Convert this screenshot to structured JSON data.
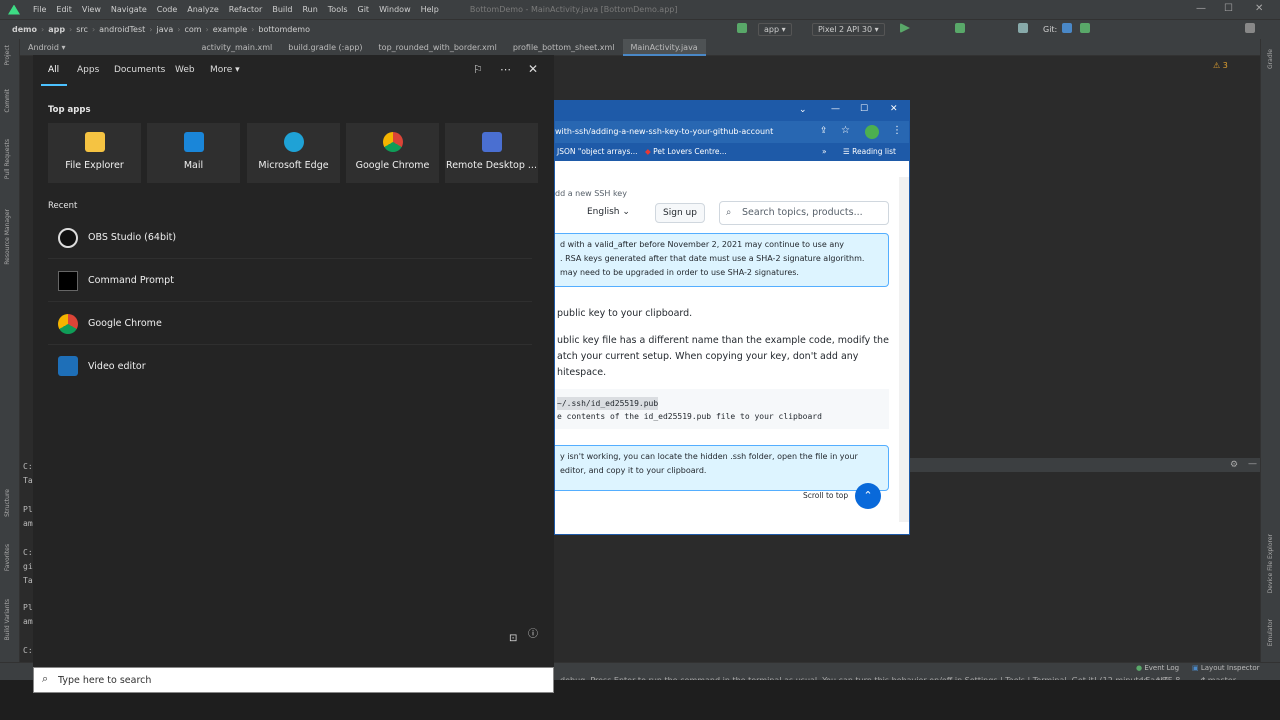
{
  "ide": {
    "menu": [
      "File",
      "Edit",
      "View",
      "Navigate",
      "Code",
      "Analyze",
      "Refactor",
      "Build",
      "Run",
      "Tools",
      "Git",
      "Window",
      "Help"
    ],
    "window_title": "BottomDemo - MainActivity.java [BottomDemo.app]",
    "breadcrumbs": [
      "demo",
      "app",
      "src",
      "androidTest",
      "java",
      "com",
      "example",
      "bottomdemo"
    ],
    "run_config": "app",
    "device": "Pixel 2 API 30",
    "git_label": "Git:",
    "project_view": "Android",
    "tabs": [
      "activity_main.xml",
      "build.gradle (:app)",
      "top_rounded_with_border.xml",
      "profile_bottom_sheet.xml",
      "MainActivity.java"
    ],
    "warning_count": "3",
    "left_panels": [
      "Project",
      "Commit",
      "Pull Requests",
      "Resource Manager",
      "Structure",
      "Favorites",
      "Build Variants"
    ],
    "right_panels": [
      "Gradle",
      "Device File Explorer",
      "Emulator"
    ],
    "terminal_fragments": [
      "C:",
      "Ta",
      "Pl",
      "am",
      "C:",
      "gi",
      "Ta",
      "Pl",
      "am",
      "C:"
    ],
    "status_message": "debug. Press Enter to run the command in the terminal as usual. You can turn this behavior on/off in Settings | Tools | Terminal. Got it! (12 minutes ago)",
    "status_lf": "LF",
    "status_encoding": "UTF-8",
    "status_branch": "master",
    "event_log": "Event Log",
    "layout_inspector": "Layout Inspector"
  },
  "browser": {
    "url": "with-ssh/adding-a-new-ssh-key-to-your-github-account",
    "bookmarks": [
      "JSON \"object arrays...",
      "Pet Lovers Centre...",
      "Reading list"
    ],
    "page": {
      "breadcrumb": "dd a new SSH key",
      "language": "English",
      "signup": "Sign up",
      "search_placeholder": "Search topics, products...",
      "note_lines": [
        "d with a  valid_after  before November 2, 2021 may continue to use any",
        ". RSA keys generated after that date must use a SHA-2 signature algorithm.",
        "may need to be upgraded in order to use SHA-2 signatures."
      ],
      "step_text": "public key to your clipboard.",
      "para_lines": [
        "ublic key file has a different name than the example code, modify the",
        "atch your current setup. When copying your key, don't add any",
        "hitespace."
      ],
      "code_lines": [
        "~/.ssh/id_ed25519.pub",
        "e contents of the id_ed25519.pub file to your clipboard"
      ],
      "tip_lines": [
        "y  isn't working, you can locate the hidden  .ssh  folder, open the file in your",
        "editor, and copy it to your clipboard."
      ],
      "scroll_to_top": "Scroll to top"
    }
  },
  "start_menu": {
    "tabs": [
      "All",
      "Apps",
      "Documents",
      "Web",
      "More"
    ],
    "top_apps_heading": "Top apps",
    "top_apps": [
      {
        "label": "File Explorer",
        "icon": "folder-icon",
        "color": "#f5c342"
      },
      {
        "label": "Mail",
        "icon": "mail-icon",
        "color": "#1a86d9"
      },
      {
        "label": "Microsoft Edge",
        "icon": "edge-icon",
        "color": "#1fa2d6"
      },
      {
        "label": "Google Chrome",
        "icon": "chrome-icon",
        "color": "#db4437"
      },
      {
        "label": "Remote Desktop ...",
        "icon": "remote-desktop-icon",
        "color": "#4a6fd1"
      }
    ],
    "recent_heading": "Recent",
    "recent": [
      {
        "label": "OBS Studio (64bit)",
        "icon": "obs-icon"
      },
      {
        "label": "Command Prompt",
        "icon": "command-prompt-icon"
      },
      {
        "label": "Google Chrome",
        "icon": "chrome-icon"
      },
      {
        "label": "Video editor",
        "icon": "video-editor-icon"
      }
    ],
    "search_placeholder": "Type here to search"
  }
}
